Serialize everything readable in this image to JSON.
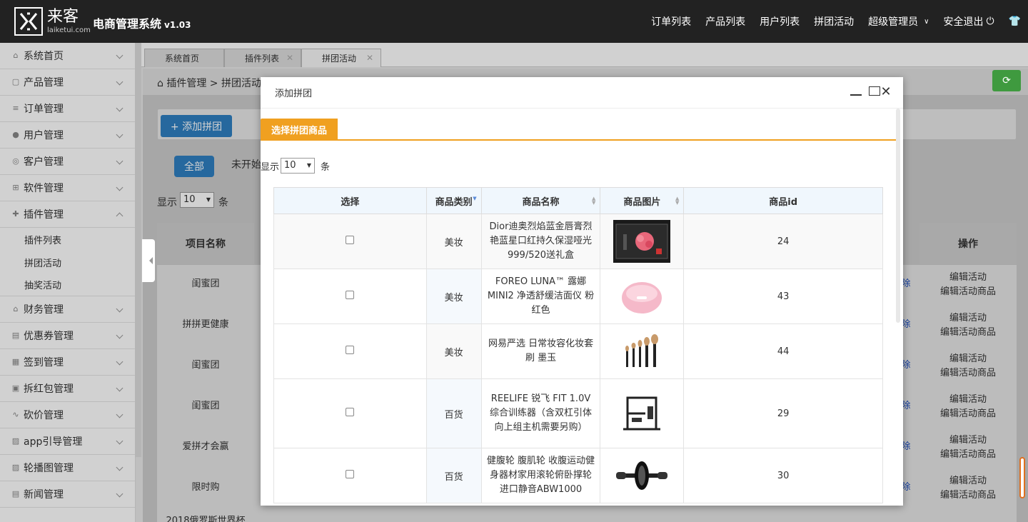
{
  "app": {
    "logo_char": "囗",
    "logo_cn": "来客",
    "logo_url": "laiketui.com",
    "title": "电商管理系统",
    "version": "v1.03"
  },
  "topnav": {
    "items": [
      "订单列表",
      "产品列表",
      "用户列表",
      "拼团活动",
      "超级管理员",
      "安全退出"
    ],
    "admin_chevron": "chevron-down-icon",
    "logout_icon": "power-icon",
    "shirt_icon": "shirt-icon"
  },
  "sidebar": {
    "items": [
      {
        "label": "系统首页",
        "icon": "home-icon"
      },
      {
        "label": "产品管理",
        "icon": "bag-icon"
      },
      {
        "label": "订单管理",
        "icon": "list-icon"
      },
      {
        "label": "用户管理",
        "icon": "user-icon"
      },
      {
        "label": "客户管理",
        "icon": "customer-icon"
      },
      {
        "label": "软件管理",
        "icon": "grid-icon"
      },
      {
        "label": "插件管理",
        "icon": "puzzle-icon",
        "expanded": true,
        "sub": [
          "插件列表",
          "拼团活动",
          "抽奖活动"
        ]
      },
      {
        "label": "财务管理",
        "icon": "bank-icon"
      },
      {
        "label": "优惠券管理",
        "icon": "coupon-icon"
      },
      {
        "label": "签到管理",
        "icon": "calendar-icon"
      },
      {
        "label": "拆红包管理",
        "icon": "gift-icon"
      },
      {
        "label": "砍价管理",
        "icon": "wave-icon"
      },
      {
        "label": "app引导管理",
        "icon": "image-icon"
      },
      {
        "label": "轮播图管理",
        "icon": "image-icon"
      },
      {
        "label": "新闻管理",
        "icon": "news-icon"
      }
    ]
  },
  "tabs": [
    {
      "label": "系统首页"
    },
    {
      "label": "插件列表"
    },
    {
      "label": "拼团活动"
    }
  ],
  "background": {
    "breadcrumb": "插件管理 > 拼团活动",
    "add_button": "+ 添加拼团",
    "filter_all": "全部",
    "filter_pending": "未开始",
    "show_label": "显示",
    "page_size": "10",
    "unit": "条",
    "col_name": "项目名称",
    "col_action": "操作",
    "rows": [
      "闺蜜团",
      "拼拼更健康",
      "闺蜜团",
      "闺蜜团",
      "爱拼才会赢",
      "限时购",
      "2018俄罗斯世界杯"
    ],
    "action1": "编辑活动",
    "action2": "编辑活动商品",
    "delete_char": "除"
  },
  "modal": {
    "title": "添加拼团",
    "section": "选择拼团商品",
    "show_label": "显示",
    "page_size": "10",
    "unit": "条",
    "columns": [
      "选择",
      "商品类别",
      "商品名称",
      "商品图片",
      "商品id"
    ],
    "rows": [
      {
        "category": "美妆",
        "name": "Dior迪奥烈焰蓝金唇膏烈艳蓝星口红持久保湿哑光999/520送礼盒",
        "image": "lipstick-giftbox-image",
        "id": "24"
      },
      {
        "category": "美妆",
        "name": "FOREO LUNA™ 露娜MINI2 净透舒缓洁面仪 粉红色",
        "image": "pink-cleanser-image",
        "id": "43"
      },
      {
        "category": "美妆",
        "name": "网易严选 日常妆容化妆套刷 墨玉",
        "image": "makeup-brushes-image",
        "id": "44"
      },
      {
        "category": "百货",
        "name": "REELIFE 锐飞 FIT 1.0V 综合训练器（含双杠引体向上组主机需要另购）",
        "image": "gym-machine-image",
        "id": "29"
      },
      {
        "category": "百货",
        "name": "健腹轮 腹肌轮 收腹运动健身器材家用滚轮俯卧撑轮进口静音ABW1000",
        "image": "ab-wheel-image",
        "id": "30"
      }
    ]
  }
}
